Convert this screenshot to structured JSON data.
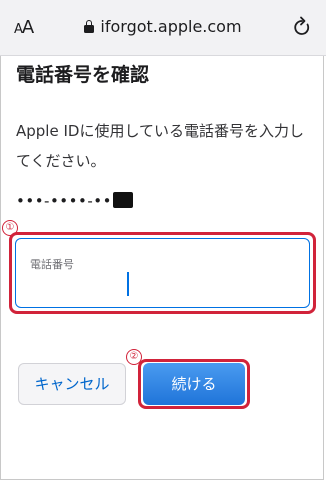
{
  "browser": {
    "text_size_button": {
      "small": "A",
      "large": "A"
    },
    "url": "iforgot.apple.com",
    "icons": {
      "lock": "lock-icon",
      "reload": "reload-icon"
    }
  },
  "page": {
    "title": "電話番号を確認",
    "description": "Apple IDに使用している電話番号を入力してください。",
    "masked_phone": "•••-••••-••"
  },
  "form": {
    "phone_field_label": "電話番号",
    "phone_value": ""
  },
  "buttons": {
    "cancel": "キャンセル",
    "continue": "続ける"
  },
  "annotations": {
    "marker_1": "①",
    "marker_2": "②",
    "highlight_color": "#d1233a"
  },
  "colors": {
    "accent": "#0071e3",
    "link": "#0066cc",
    "continue_gradient_top": "#4a9bf0",
    "continue_gradient_bottom": "#1f74d9"
  }
}
